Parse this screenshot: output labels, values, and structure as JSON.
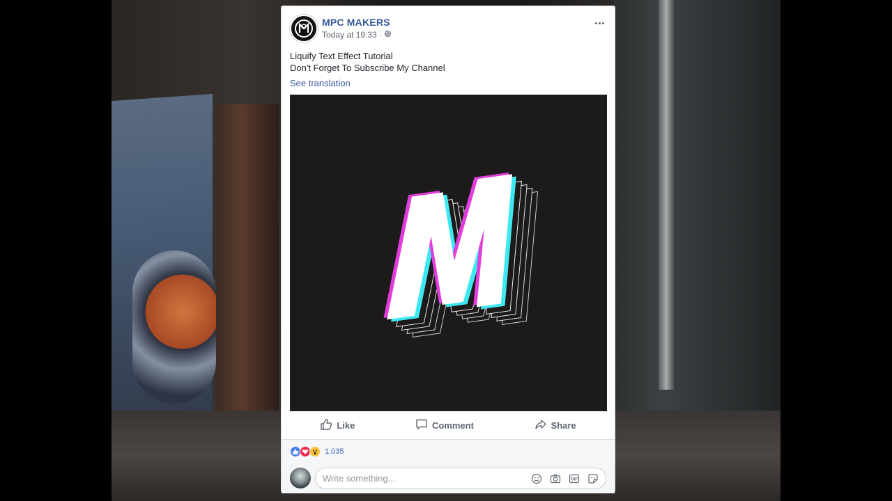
{
  "post": {
    "page_name": "MPC MAKERS",
    "timestamp": "Today at 19:33",
    "separator": "·",
    "text_line1": "Liquify Text Effect Tutorial",
    "text_line2": "Don't Forget To Subscribe My Channel",
    "see_translation": "See translation",
    "image_letter": "M"
  },
  "actions": {
    "like": "Like",
    "comment": "Comment",
    "share": "Share"
  },
  "reactions": {
    "count": "1.035",
    "types": [
      "like",
      "love",
      "wow"
    ]
  },
  "comment_box": {
    "placeholder": "Write something..."
  },
  "icons": [
    "more-icon",
    "globe-icon",
    "like-icon",
    "comment-icon",
    "share-icon",
    "emoji-icon",
    "camera-icon",
    "gif-icon",
    "sticker-icon"
  ],
  "colors": {
    "link_blue": "#365899",
    "image_bg": "#1c1a1b",
    "glitch_magenta": "#e23ddc",
    "glitch_cyan": "#3ee8f0"
  }
}
